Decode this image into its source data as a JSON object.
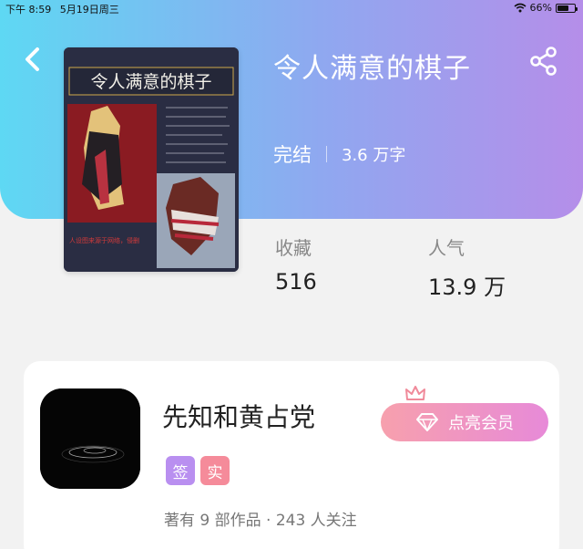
{
  "status_bar": {
    "time": "下午 8:59",
    "date": "5月19日周三",
    "battery": "66%",
    "battery_level": 0.66
  },
  "book": {
    "title": "令人满意的棋子",
    "status": "完结",
    "word_count": "3.6 万字",
    "cover": {
      "title_text": "令人满意的棋子",
      "caption": "人设图来源于网络，侵删"
    }
  },
  "stats": {
    "favorites_label": "收藏",
    "favorites_value": "516",
    "popularity_label": "人气",
    "popularity_value": "13.9 万"
  },
  "author": {
    "name": "先知和黄占党",
    "badges": [
      "签",
      "实"
    ],
    "works_summary": "著有 9 部作品 · 243 人关注"
  },
  "vip_button": {
    "label": "点亮会员"
  },
  "icons": [
    "back-arrow-icon",
    "share-icon",
    "wifi-icon",
    "battery-icon",
    "crown-icon",
    "diamond-icon"
  ],
  "colors": {
    "hero_gradient_start": "#5ed8f3",
    "hero_gradient_end": "#b58ee9",
    "sign_badge": "#b98ff0",
    "real_badge": "#f58b9a",
    "vip_gradient_start": "#f7a0ad",
    "vip_gradient_end": "#e78ad8",
    "crown": "#f08a9a"
  }
}
